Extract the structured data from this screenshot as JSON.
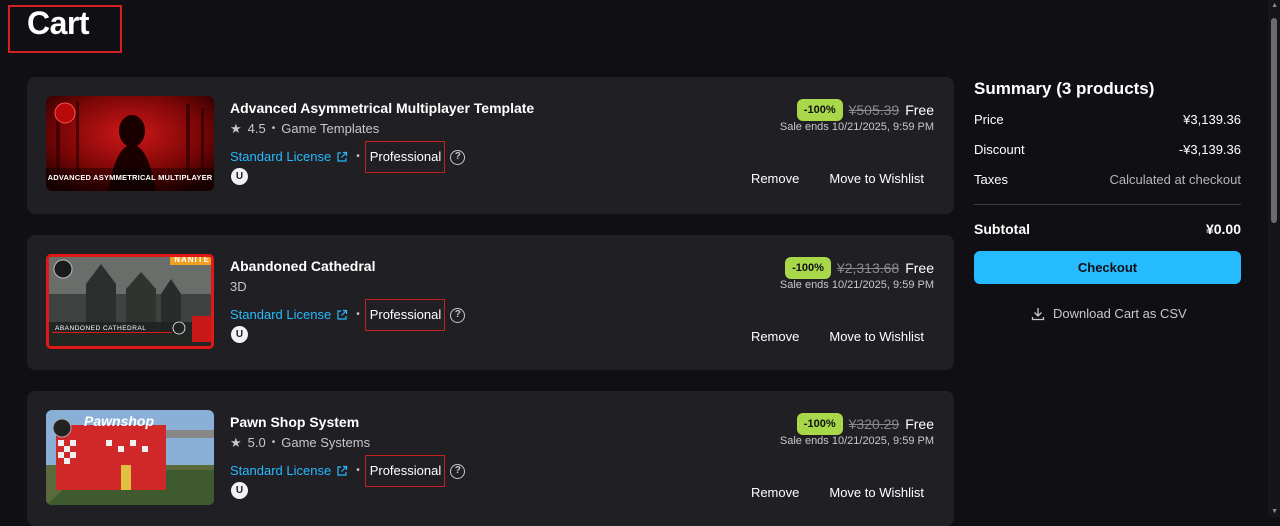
{
  "page": {
    "title": "Cart"
  },
  "items": [
    {
      "title": "Advanced Asymmetrical Multiplayer Template",
      "rating": "4.5",
      "category": "Game Templates",
      "license": "Standard License",
      "tier": "Professional",
      "discount": "-100%",
      "original_price": "¥505.39",
      "final_price": "Free",
      "sale_ends": "Sale ends 10/21/2025, 9:59 PM",
      "remove_label": "Remove",
      "wishlist_label": "Move to Wishlist",
      "thumb_caption": "ADVANCED ASYMMETRICAL MULTIPLAYER"
    },
    {
      "title": "Abandoned Cathedral",
      "rating": "",
      "category": "3D",
      "license": "Standard License",
      "tier": "Professional",
      "discount": "-100%",
      "original_price": "¥2,313.68",
      "final_price": "Free",
      "sale_ends": "Sale ends 10/21/2025, 9:59 PM",
      "remove_label": "Remove",
      "wishlist_label": "Move to Wishlist",
      "thumb_caption": "ABANDONED CATHEDRAL",
      "thumb_badge": "NANITE"
    },
    {
      "title": "Pawn Shop System",
      "rating": "5.0",
      "category": "Game Systems",
      "license": "Standard License",
      "tier": "Professional",
      "discount": "-100%",
      "original_price": "¥320.29",
      "final_price": "Free",
      "sale_ends": "Sale ends 10/21/2025, 9:59 PM",
      "remove_label": "Remove",
      "wishlist_label": "Move to Wishlist",
      "thumb_caption": "Pawnshop"
    }
  ],
  "summary": {
    "title": "Summary (3 products)",
    "price_label": "Price",
    "price_value": "¥3,139.36",
    "discount_label": "Discount",
    "discount_value": "-¥3,139.36",
    "taxes_label": "Taxes",
    "taxes_value": "Calculated at checkout",
    "subtotal_label": "Subtotal",
    "subtotal_value": "¥0.00",
    "checkout_label": "Checkout",
    "csv_label": "Download Cart as CSV"
  },
  "colors": {
    "background": "#101014",
    "card": "#202024",
    "accent": "#26bbff",
    "discount_badge": "#a8d84a",
    "highlight_border": "#d32020"
  }
}
